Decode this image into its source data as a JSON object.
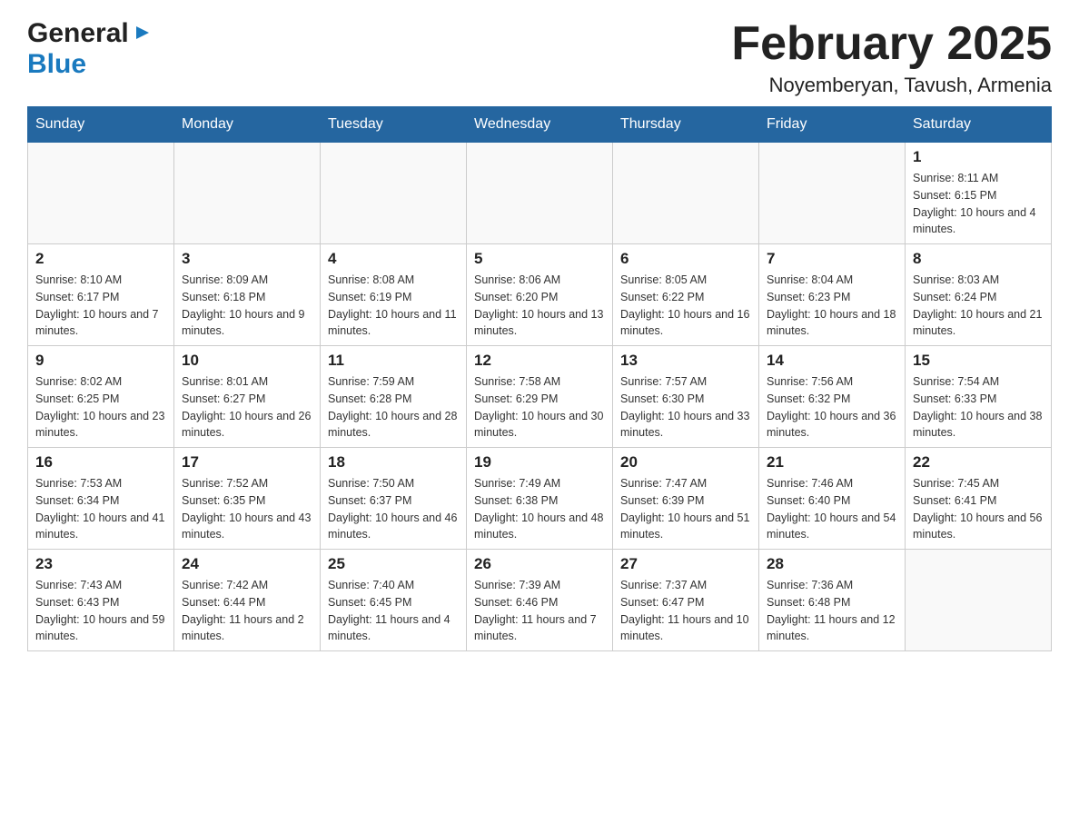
{
  "header": {
    "title": "February 2025",
    "subtitle": "Noyemberyan, Tavush, Armenia",
    "logo_general": "General",
    "logo_blue": "Blue"
  },
  "weekdays": [
    "Sunday",
    "Monday",
    "Tuesday",
    "Wednesday",
    "Thursday",
    "Friday",
    "Saturday"
  ],
  "weeks": [
    [
      {
        "day": "",
        "sunrise": "",
        "sunset": "",
        "daylight": ""
      },
      {
        "day": "",
        "sunrise": "",
        "sunset": "",
        "daylight": ""
      },
      {
        "day": "",
        "sunrise": "",
        "sunset": "",
        "daylight": ""
      },
      {
        "day": "",
        "sunrise": "",
        "sunset": "",
        "daylight": ""
      },
      {
        "day": "",
        "sunrise": "",
        "sunset": "",
        "daylight": ""
      },
      {
        "day": "",
        "sunrise": "",
        "sunset": "",
        "daylight": ""
      },
      {
        "day": "1",
        "sunrise": "Sunrise: 8:11 AM",
        "sunset": "Sunset: 6:15 PM",
        "daylight": "Daylight: 10 hours and 4 minutes."
      }
    ],
    [
      {
        "day": "2",
        "sunrise": "Sunrise: 8:10 AM",
        "sunset": "Sunset: 6:17 PM",
        "daylight": "Daylight: 10 hours and 7 minutes."
      },
      {
        "day": "3",
        "sunrise": "Sunrise: 8:09 AM",
        "sunset": "Sunset: 6:18 PM",
        "daylight": "Daylight: 10 hours and 9 minutes."
      },
      {
        "day": "4",
        "sunrise": "Sunrise: 8:08 AM",
        "sunset": "Sunset: 6:19 PM",
        "daylight": "Daylight: 10 hours and 11 minutes."
      },
      {
        "day": "5",
        "sunrise": "Sunrise: 8:06 AM",
        "sunset": "Sunset: 6:20 PM",
        "daylight": "Daylight: 10 hours and 13 minutes."
      },
      {
        "day": "6",
        "sunrise": "Sunrise: 8:05 AM",
        "sunset": "Sunset: 6:22 PM",
        "daylight": "Daylight: 10 hours and 16 minutes."
      },
      {
        "day": "7",
        "sunrise": "Sunrise: 8:04 AM",
        "sunset": "Sunset: 6:23 PM",
        "daylight": "Daylight: 10 hours and 18 minutes."
      },
      {
        "day": "8",
        "sunrise": "Sunrise: 8:03 AM",
        "sunset": "Sunset: 6:24 PM",
        "daylight": "Daylight: 10 hours and 21 minutes."
      }
    ],
    [
      {
        "day": "9",
        "sunrise": "Sunrise: 8:02 AM",
        "sunset": "Sunset: 6:25 PM",
        "daylight": "Daylight: 10 hours and 23 minutes."
      },
      {
        "day": "10",
        "sunrise": "Sunrise: 8:01 AM",
        "sunset": "Sunset: 6:27 PM",
        "daylight": "Daylight: 10 hours and 26 minutes."
      },
      {
        "day": "11",
        "sunrise": "Sunrise: 7:59 AM",
        "sunset": "Sunset: 6:28 PM",
        "daylight": "Daylight: 10 hours and 28 minutes."
      },
      {
        "day": "12",
        "sunrise": "Sunrise: 7:58 AM",
        "sunset": "Sunset: 6:29 PM",
        "daylight": "Daylight: 10 hours and 30 minutes."
      },
      {
        "day": "13",
        "sunrise": "Sunrise: 7:57 AM",
        "sunset": "Sunset: 6:30 PM",
        "daylight": "Daylight: 10 hours and 33 minutes."
      },
      {
        "day": "14",
        "sunrise": "Sunrise: 7:56 AM",
        "sunset": "Sunset: 6:32 PM",
        "daylight": "Daylight: 10 hours and 36 minutes."
      },
      {
        "day": "15",
        "sunrise": "Sunrise: 7:54 AM",
        "sunset": "Sunset: 6:33 PM",
        "daylight": "Daylight: 10 hours and 38 minutes."
      }
    ],
    [
      {
        "day": "16",
        "sunrise": "Sunrise: 7:53 AM",
        "sunset": "Sunset: 6:34 PM",
        "daylight": "Daylight: 10 hours and 41 minutes."
      },
      {
        "day": "17",
        "sunrise": "Sunrise: 7:52 AM",
        "sunset": "Sunset: 6:35 PM",
        "daylight": "Daylight: 10 hours and 43 minutes."
      },
      {
        "day": "18",
        "sunrise": "Sunrise: 7:50 AM",
        "sunset": "Sunset: 6:37 PM",
        "daylight": "Daylight: 10 hours and 46 minutes."
      },
      {
        "day": "19",
        "sunrise": "Sunrise: 7:49 AM",
        "sunset": "Sunset: 6:38 PM",
        "daylight": "Daylight: 10 hours and 48 minutes."
      },
      {
        "day": "20",
        "sunrise": "Sunrise: 7:47 AM",
        "sunset": "Sunset: 6:39 PM",
        "daylight": "Daylight: 10 hours and 51 minutes."
      },
      {
        "day": "21",
        "sunrise": "Sunrise: 7:46 AM",
        "sunset": "Sunset: 6:40 PM",
        "daylight": "Daylight: 10 hours and 54 minutes."
      },
      {
        "day": "22",
        "sunrise": "Sunrise: 7:45 AM",
        "sunset": "Sunset: 6:41 PM",
        "daylight": "Daylight: 10 hours and 56 minutes."
      }
    ],
    [
      {
        "day": "23",
        "sunrise": "Sunrise: 7:43 AM",
        "sunset": "Sunset: 6:43 PM",
        "daylight": "Daylight: 10 hours and 59 minutes."
      },
      {
        "day": "24",
        "sunrise": "Sunrise: 7:42 AM",
        "sunset": "Sunset: 6:44 PM",
        "daylight": "Daylight: 11 hours and 2 minutes."
      },
      {
        "day": "25",
        "sunrise": "Sunrise: 7:40 AM",
        "sunset": "Sunset: 6:45 PM",
        "daylight": "Daylight: 11 hours and 4 minutes."
      },
      {
        "day": "26",
        "sunrise": "Sunrise: 7:39 AM",
        "sunset": "Sunset: 6:46 PM",
        "daylight": "Daylight: 11 hours and 7 minutes."
      },
      {
        "day": "27",
        "sunrise": "Sunrise: 7:37 AM",
        "sunset": "Sunset: 6:47 PM",
        "daylight": "Daylight: 11 hours and 10 minutes."
      },
      {
        "day": "28",
        "sunrise": "Sunrise: 7:36 AM",
        "sunset": "Sunset: 6:48 PM",
        "daylight": "Daylight: 11 hours and 12 minutes."
      },
      {
        "day": "",
        "sunrise": "",
        "sunset": "",
        "daylight": ""
      }
    ]
  ]
}
